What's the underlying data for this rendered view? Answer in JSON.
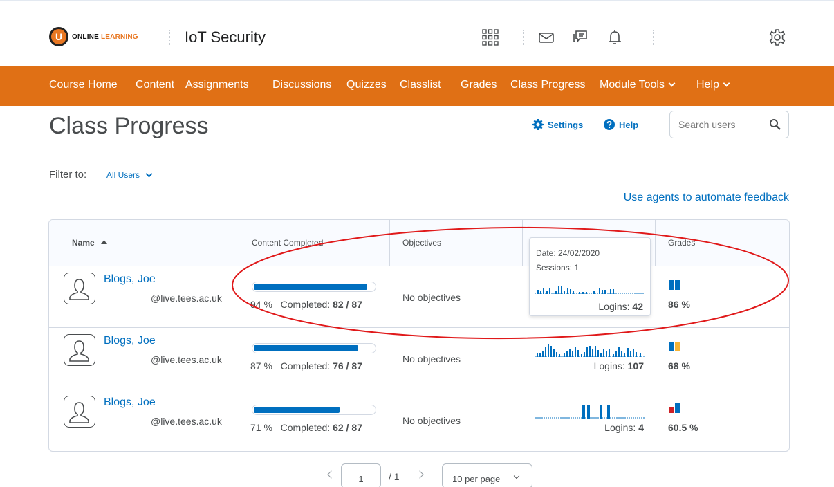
{
  "brand": {
    "logo_letter": "U",
    "logo_text_1": "ONLINE",
    "logo_text_2": "LEARNING",
    "accent": "#e07015",
    "link": "#006fbf"
  },
  "course_title": "IoT Security",
  "top_icons": [
    "waffle-icon",
    "mail-icon",
    "chat-icon",
    "bell-icon",
    "gear-icon"
  ],
  "nav": {
    "items": [
      "Course Home",
      "Content",
      "Assignments",
      "Discussions",
      "Quizzes",
      "Classlist",
      "Grades",
      "Class Progress"
    ],
    "module_tools": "Module Tools",
    "help": "Help"
  },
  "page": {
    "title": "Class Progress",
    "settings": "Settings",
    "help": "Help",
    "search_placeholder": "Search users"
  },
  "filter": {
    "label": "Filter to:",
    "value": "All Users"
  },
  "agents_link": "Use agents to automate feedback",
  "table": {
    "headers": {
      "name": "Name",
      "content": "Content Completed",
      "objectives": "Objectives",
      "logins": "",
      "grades": "Grades"
    },
    "rows": [
      {
        "name": "Blogs, Joe",
        "email": "@live.tees.ac.uk",
        "progress": 0.94,
        "pct": "94 %",
        "completed_label": "Completed:",
        "completed": "82 / 87",
        "objectives": "No objectives",
        "logins_label": "Logins:",
        "logins": "42",
        "grades_label": "86 %",
        "grade_bars": [
          1,
          1
        ],
        "grade_colors": [
          "#006fbf",
          "#006fbf"
        ]
      },
      {
        "name": "Blogs, Joe",
        "email": "@live.tees.ac.uk",
        "progress": 0.87,
        "pct": "87 %",
        "completed_label": "Completed:",
        "completed": "76 / 87",
        "objectives": "No objectives",
        "logins_label": "Logins:",
        "logins": "107",
        "grades_label": "68 %",
        "grade_bars": [
          1,
          1
        ],
        "grade_colors": [
          "#006fbf",
          "#f5b335"
        ]
      },
      {
        "name": "Blogs, Joe",
        "email": "@live.tees.ac.uk",
        "progress": 0.71,
        "pct": "71 %",
        "completed_label": "Completed:",
        "completed": "62 / 87",
        "objectives": "No objectives",
        "logins_label": "Logins:",
        "logins": "4",
        "grades_label": "60.5 %",
        "grade_bars": [
          0.55,
          1
        ],
        "grade_colors": [
          "#cd2026",
          "#006fbf"
        ]
      }
    ]
  },
  "tooltip": {
    "date": "Date: 24/02/2020",
    "sessions": "Sessions: 1"
  },
  "pager": {
    "page": "1",
    "total": "/ 1",
    "per_page": "10 per page"
  },
  "annotation_color": "#e0191a"
}
